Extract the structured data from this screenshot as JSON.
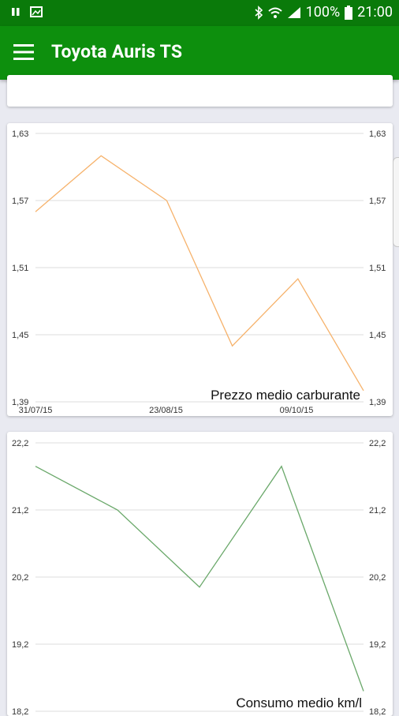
{
  "status": {
    "battery": "100%",
    "time": "21:00"
  },
  "app_bar": {
    "title": "Toyota Auris TS",
    "menu_icon": "hamburger-menu-icon"
  },
  "colors": {
    "primary": "#0d8f0d",
    "status_bar": "#0a7a0a",
    "price_line": "#f6b26b",
    "consumption_line": "#6aa86a"
  },
  "chart_data": [
    {
      "type": "line",
      "title": "Prezzo medio carburante",
      "x_ticks": [
        "31/07/15",
        "23/08/15",
        "09/10/15"
      ],
      "y_ticks": [
        "1,63",
        "1,57",
        "1,51",
        "1,45",
        "1,39"
      ],
      "ylim": [
        1.39,
        1.63
      ],
      "y_axis_sides": [
        "left",
        "right"
      ],
      "grid": true,
      "series": [
        {
          "values": [
            1.56,
            1.61,
            1.57,
            1.44,
            1.5,
            1.4
          ]
        }
      ]
    },
    {
      "type": "line",
      "title": "Consumo medio km/l",
      "y_ticks": [
        "22,2",
        "21,2",
        "20,2",
        "19,2",
        "18,2"
      ],
      "ylim": [
        18.2,
        22.2
      ],
      "y_axis_sides": [
        "left",
        "right"
      ],
      "grid": true,
      "series": [
        {
          "values": [
            21.85,
            21.2,
            20.05,
            21.85,
            18.5
          ]
        }
      ]
    }
  ]
}
